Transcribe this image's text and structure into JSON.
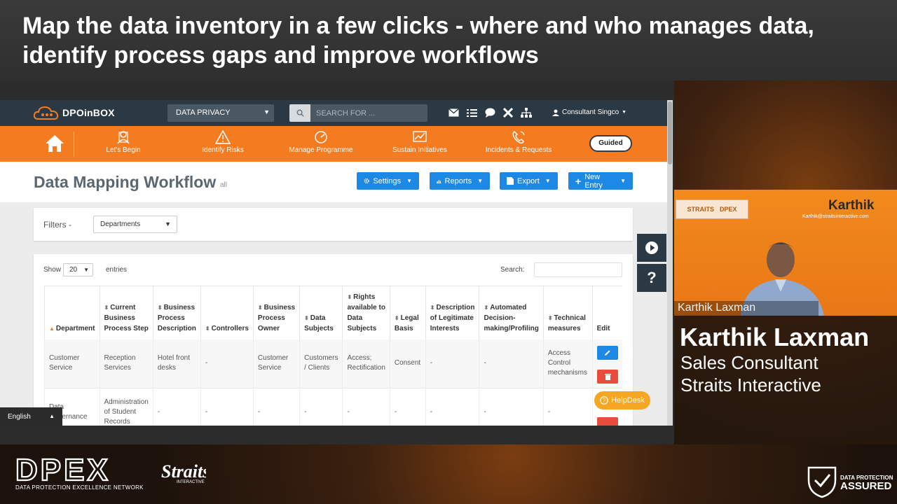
{
  "banner": {
    "headline": "Map the data inventory in a few clicks - where and who manages data, identify process gaps and improve workflows"
  },
  "app": {
    "logo_text": "DPOinBOX",
    "module": "DATA PRIVACY",
    "search_placeholder": "SEARCH FOR ...",
    "user": "Consultant Singco",
    "top_icons": [
      "mail-icon",
      "checklist-icon",
      "chat-icon",
      "tools-icon",
      "sitemap-icon"
    ],
    "nav": [
      {
        "label": "Let's Begin",
        "icon": "users-icon"
      },
      {
        "label": "Identify Risks",
        "icon": "warning-icon"
      },
      {
        "label": "Manage Programme",
        "icon": "dashboard-icon"
      },
      {
        "label": "Sustain Initiatives",
        "icon": "chart-icon"
      },
      {
        "label": "Incidents & Requests",
        "icon": "phone-icon"
      }
    ],
    "guided_label": "Guided",
    "page_title": "Data Mapping Workflow",
    "page_title_sub": "all",
    "buttons": {
      "settings": "Settings",
      "reports": "Reports",
      "export": "Export",
      "new_entry": "New Entry"
    },
    "filters": {
      "label": "Filters -",
      "selected": "Departments"
    },
    "table": {
      "show_label": "Show",
      "show_value": "20",
      "entries_label": "entries",
      "search_label": "Search:",
      "columns": [
        "Department",
        "Current Business Process Step",
        "Business Process Description",
        "Controllers",
        "Business Process Owner",
        "Data Subjects",
        "Rights available to Data Subjects",
        "Legal Basis",
        "Description of Legitimate Interests",
        "Automated Decision-making/Profiling",
        "Technical measures",
        "Edit"
      ],
      "rows": [
        [
          "Customer Service",
          "Reception Services",
          "Hotel front desks",
          "-",
          "Customer Service",
          "Customers / Clients",
          "Access; Rectification",
          "Consent",
          "-",
          "-",
          "Access Control mechanisms"
        ],
        [
          "Data Governance",
          "Administration of Student Records",
          "-",
          "-",
          "-",
          "-",
          "-",
          "-",
          "-",
          "-",
          "-"
        ]
      ]
    },
    "helpdesk_label": "HelpDesk",
    "language": "English"
  },
  "video": {
    "overlay_name": "Karthik",
    "overlay_email": "Karthik@straitsinteractive.com",
    "lower_third": "Karthik Laxman",
    "logos_text_left": "STRAITS",
    "logos_text_right": "DPEX"
  },
  "speaker": {
    "name": "Karthik Laxman",
    "role": "Sales Consultant",
    "company": "Straits Interactive"
  },
  "footer": {
    "dpex_sub": "DATA PROTECTION EXCELLENCE NETWORK",
    "straits_sub": "INTERACTIVE",
    "dpa_line1": "DATA PROTECTION",
    "dpa_line2": "ASSURED"
  },
  "colors": {
    "orange": "#f47b20",
    "navy": "#2b3944",
    "blue": "#1e88e5",
    "red": "#e74c3c",
    "helpdesk": "#f5a623"
  }
}
